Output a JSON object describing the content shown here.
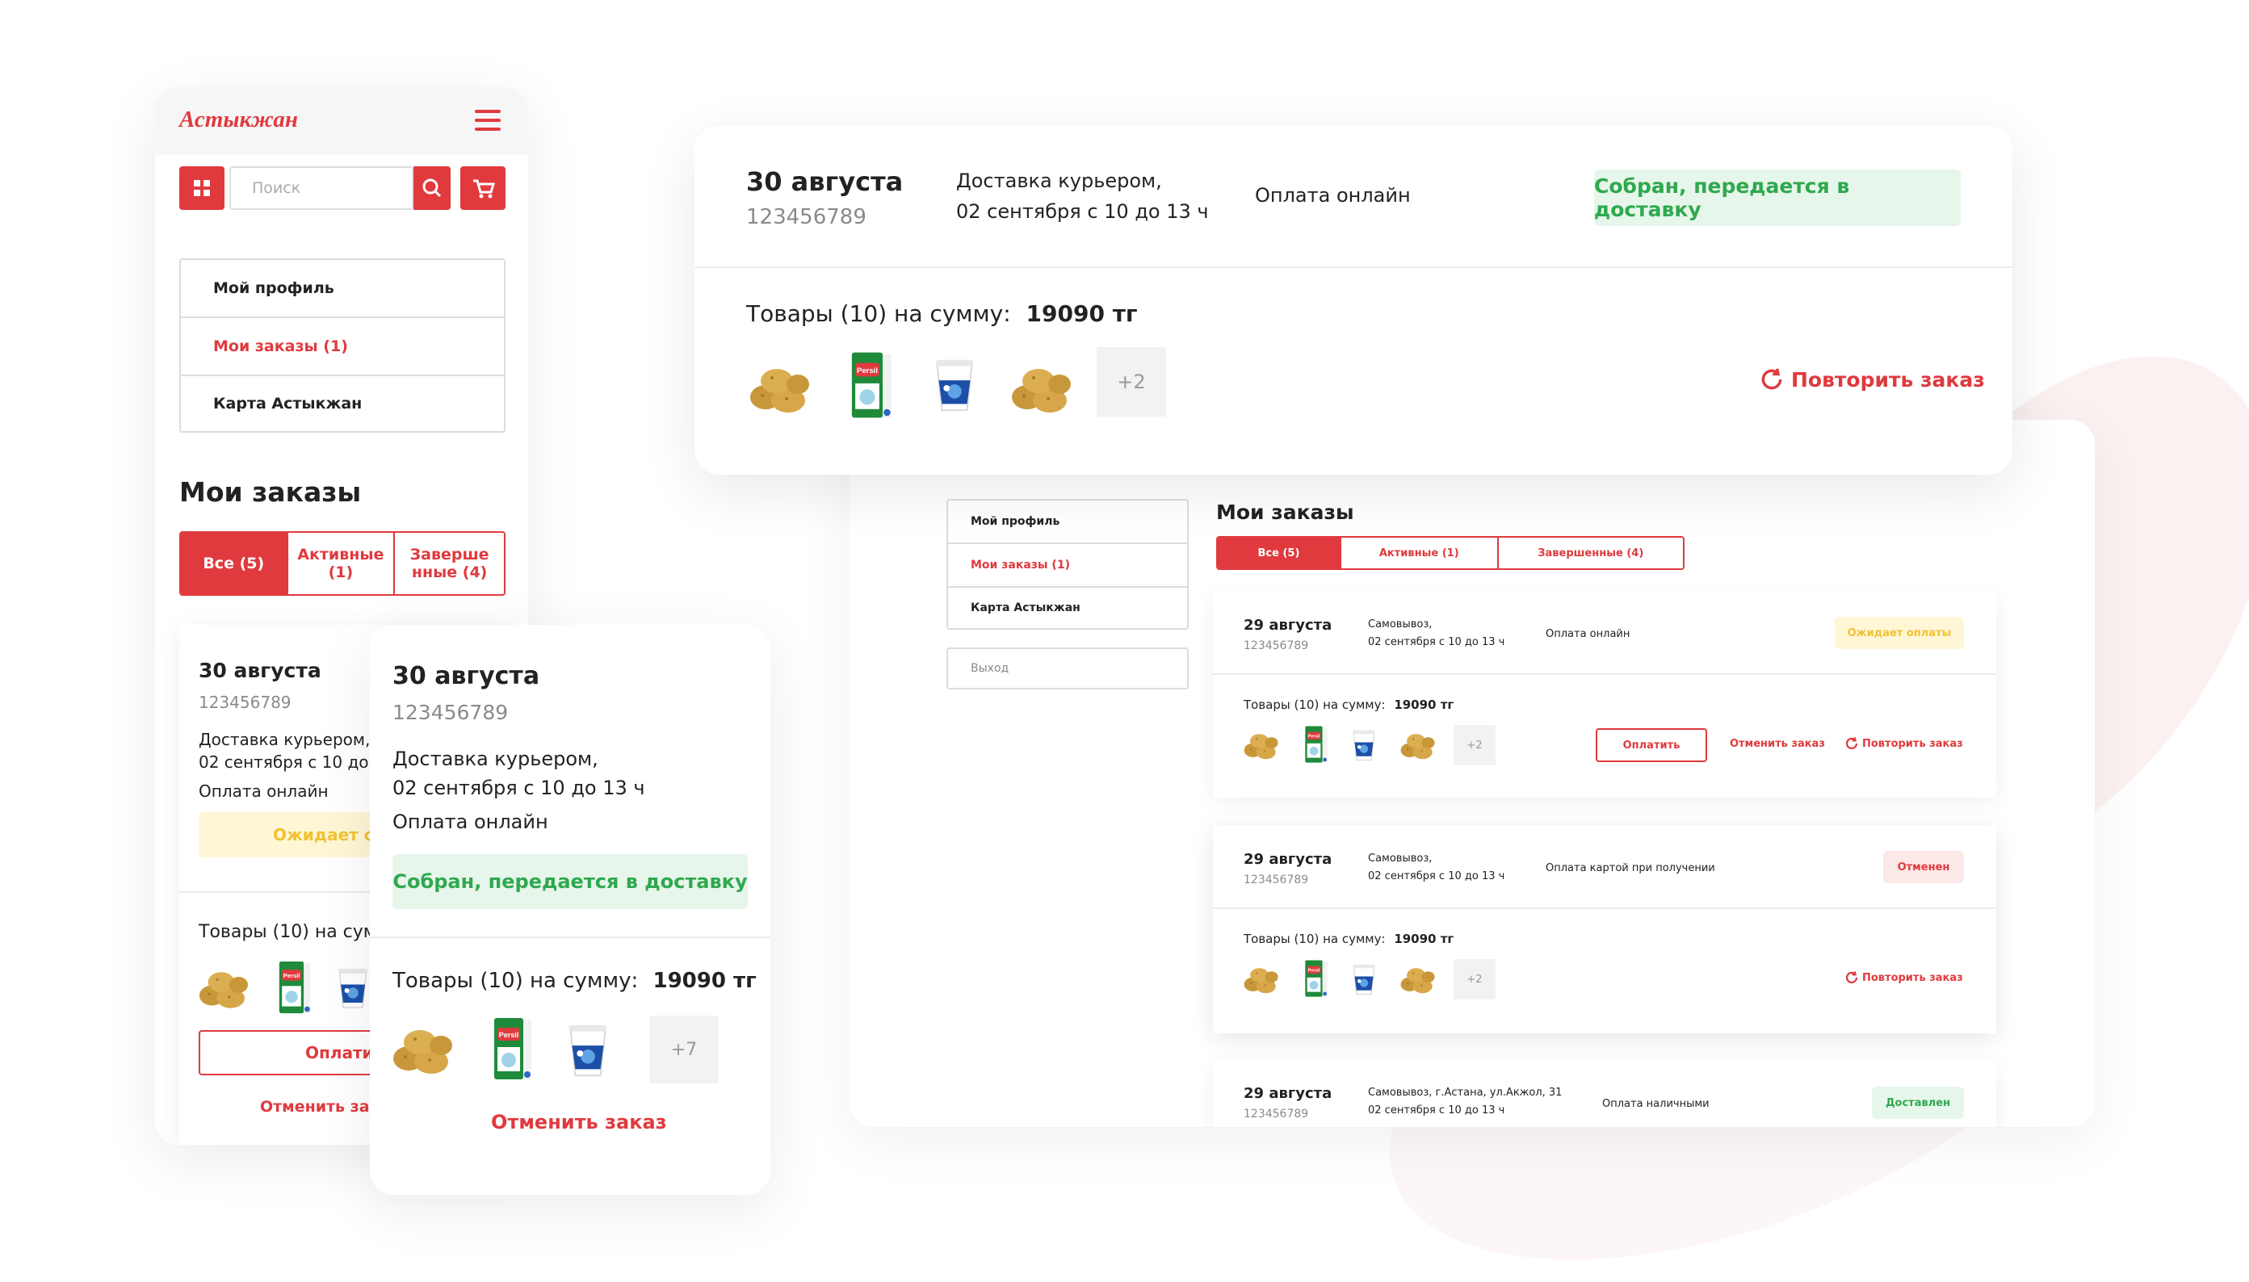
{
  "brand": {
    "logo_text": "Астыкжан",
    "accent": "#e03a3e",
    "green": "#2fa84f",
    "yellow": "#f1c232"
  },
  "mobile": {
    "search_placeholder": "Поиск",
    "menu": [
      "Мой профиль",
      "Мои заказы (1)",
      "Карта Астыкжан"
    ],
    "heading": "Мои заказы",
    "tabs": [
      "Все (5)",
      "Активные (1)",
      "Завершенные (4)"
    ],
    "order_back": {
      "date": "30 августа",
      "number": "123456789",
      "delivery_line1": "Доставка курьером,",
      "delivery_line2": "02 сентября с 10 до 13 ч",
      "payment": "Оплата онлайн",
      "status": "Ожидает оплаты",
      "goods": "Товары (10) на сумму",
      "pay_button": "Оплатить",
      "cancel_link": "Отменить заказ"
    },
    "order_front": {
      "date": "30 августа",
      "number": "123456789",
      "delivery_line1": "Доставка курьером,",
      "delivery_line2": "02 сентября с 10 до 13 ч",
      "payment": "Оплата онлайн",
      "status": "Собран, передается в доставку",
      "goods_label": "Товары (10) на сумму:",
      "goods_sum": "19090 тг",
      "more_count": "+7",
      "cancel_link": "Отменить заказ"
    }
  },
  "top_card": {
    "date": "30 августа",
    "number": "123456789",
    "delivery_line1": "Доставка курьером,",
    "delivery_line2": "02 сентября с 10 до 13 ч",
    "payment": "Оплата онлайн",
    "status": "Собран, передается в доставку",
    "goods_label": "Товары (10) на сумму:",
    "goods_sum": "19090 тг",
    "more_count": "+2",
    "repeat": "Повторить заказ"
  },
  "desktop": {
    "menu": [
      "Мой профиль",
      "Мои заказы (1)",
      "Карта Астыкжан"
    ],
    "logout": "Выход",
    "heading": "Мои заказы",
    "tabs": [
      "Все (5)",
      "Активные (1)",
      "Завершенные (4)"
    ],
    "orders": [
      {
        "date": "29 августа",
        "number": "123456789",
        "delivery_line1": "Самовывоз,",
        "delivery_line2": "02 сентября с 10 до 13 ч",
        "payment": "Оплата онлайн",
        "status": "Ожидает оплаты",
        "goods_label": "Товары (10) на сумму:",
        "goods_sum": "19090 тг",
        "more_count": "+2",
        "pay": "Оплатить",
        "cancel": "Отменить заказ",
        "repeat": "Повторить заказ"
      },
      {
        "date": "29 августа",
        "number": "123456789",
        "delivery_line1": "Самовывоз,",
        "delivery_line2": "02 сентября с 10 до 13 ч",
        "payment": "Оплата картой при получении",
        "status": "Отменен",
        "goods_label": "Товары (10) на сумму:",
        "goods_sum": "19090 тг",
        "more_count": "+2",
        "repeat": "Повторить заказ"
      },
      {
        "date": "29 августа",
        "number": "123456789",
        "delivery_line1": "Самовывоз, г.Астана, ул.Акжол, 31",
        "delivery_line2": "02 сентября с 10 до 13 ч",
        "payment": "Оплата наличными",
        "status": "Доставлен"
      }
    ]
  }
}
